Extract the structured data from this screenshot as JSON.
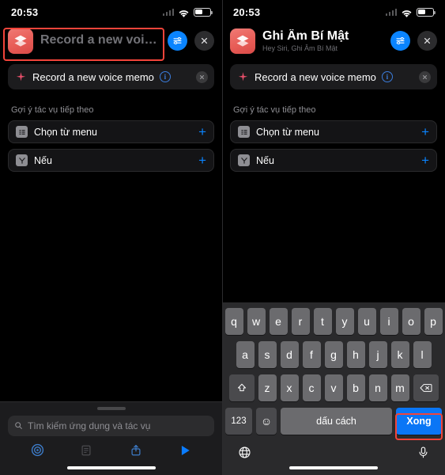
{
  "left": {
    "status": {
      "time": "20:53"
    },
    "header": {
      "title_placeholder": "Record a new voice...",
      "subtitle": "",
      "settings_icon": "sliders-icon",
      "close_icon": "close-icon"
    },
    "action": {
      "icon": "voice-memo-icon",
      "label": "Record a new voice memo",
      "info_char": "i",
      "close_icon": "remove-action-icon"
    },
    "suggestions": {
      "title": "Gợi ý tác vụ tiếp theo",
      "items": [
        {
          "label": "Chọn từ menu",
          "icon": "menu-list-icon",
          "add": "+"
        },
        {
          "label": "Nếu",
          "icon": "if-condition-icon",
          "add": "+"
        }
      ]
    },
    "search": {
      "placeholder": "Tìm kiếm ứng dụng và tác vụ",
      "icon": "search-icon"
    },
    "toolbar": [
      {
        "name": "shortcuts-icon"
      },
      {
        "name": "variables-icon"
      },
      {
        "name": "share-icon"
      },
      {
        "name": "play-icon"
      }
    ]
  },
  "right": {
    "status": {
      "time": "20:53"
    },
    "header": {
      "title": "Ghi Âm Bí Mật",
      "subtitle": "Hey Siri, Ghi Âm Bí Mật",
      "settings_icon": "sliders-icon",
      "close_icon": "close-icon"
    },
    "action": {
      "icon": "voice-memo-icon",
      "label": "Record a new voice memo",
      "info_char": "i",
      "close_icon": "remove-action-icon"
    },
    "suggestions": {
      "title": "Gợi ý tác vụ tiếp theo",
      "items": [
        {
          "label": "Chọn từ menu",
          "icon": "menu-list-icon",
          "add": "+"
        },
        {
          "label": "Nếu",
          "icon": "if-condition-icon",
          "add": "+"
        }
      ]
    },
    "keyboard": {
      "row1": [
        "q",
        "w",
        "e",
        "r",
        "t",
        "y",
        "u",
        "i",
        "o",
        "p"
      ],
      "row2": [
        "a",
        "s",
        "d",
        "f",
        "g",
        "h",
        "j",
        "k",
        "l"
      ],
      "row3": [
        "z",
        "x",
        "c",
        "v",
        "b",
        "n",
        "m"
      ],
      "shift_icon": "shift-icon",
      "backspace_icon": "backspace-icon",
      "numbers_label": "123",
      "emoji_label": "☺",
      "space_label": "dấu cách",
      "done_label": "Xong",
      "globe_icon": "globe-icon",
      "mic_icon": "microphone-icon"
    }
  },
  "highlight_color": "#f2443a",
  "accent_blue": "#0a84ff"
}
